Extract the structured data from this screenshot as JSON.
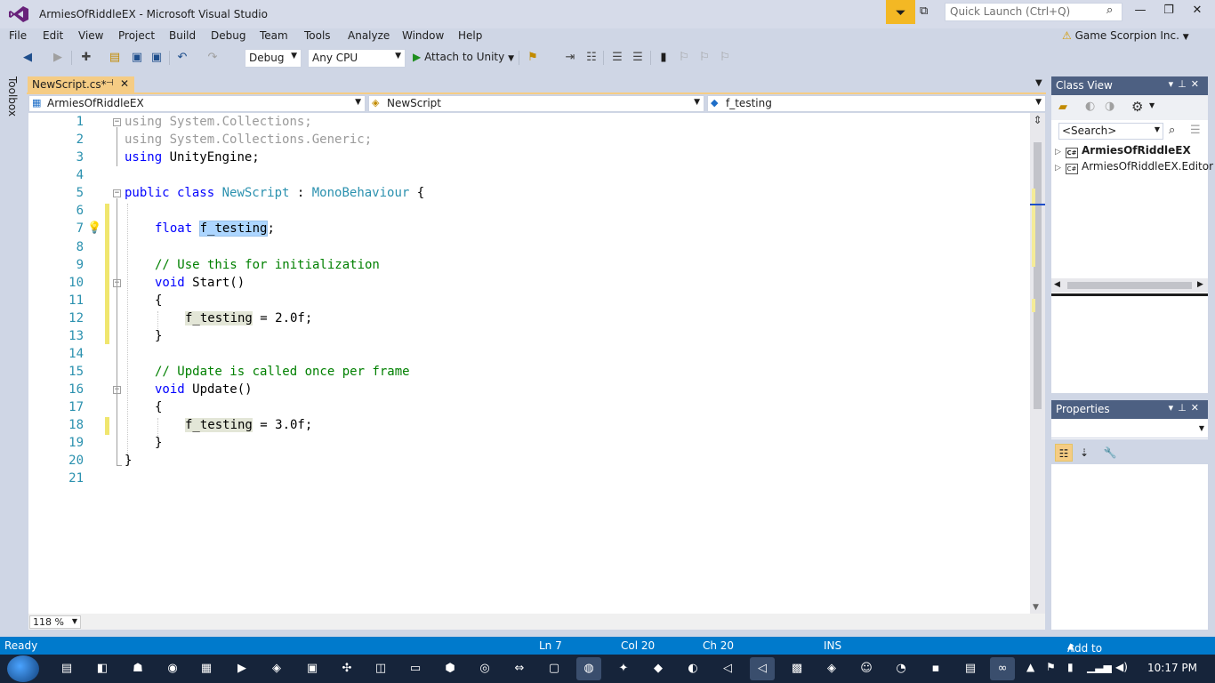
{
  "window": {
    "title": "ArmiesOfRiddleEX - Microsoft Visual Studio",
    "quick_launch_placeholder": "Quick Launch (Ctrl+Q)",
    "account": "Game Scorpion Inc.",
    "accent": "#007acc"
  },
  "menu": [
    "File",
    "Edit",
    "View",
    "Project",
    "Build",
    "Debug",
    "Team",
    "Tools",
    "Analyze",
    "Window",
    "Help"
  ],
  "toolbar": {
    "configuration": "Debug",
    "platform": "Any CPU",
    "attach_label": "Attach to Unity"
  },
  "sidebar": {
    "toolbox_label": "Toolbox"
  },
  "document": {
    "tab_title": "NewScript.cs*",
    "nav_project": "ArmiesOfRiddleEX",
    "nav_type": "NewScript",
    "nav_member": "f_testing",
    "zoom": "118 %"
  },
  "code_lines": [
    {
      "n": "1"
    },
    {
      "n": "2"
    },
    {
      "n": "3"
    },
    {
      "n": "4"
    },
    {
      "n": "5"
    },
    {
      "n": "6"
    },
    {
      "n": "7"
    },
    {
      "n": "8"
    },
    {
      "n": "9"
    },
    {
      "n": "10"
    },
    {
      "n": "11"
    },
    {
      "n": "12"
    },
    {
      "n": "13"
    },
    {
      "n": "14"
    },
    {
      "n": "15"
    },
    {
      "n": "16"
    },
    {
      "n": "17"
    },
    {
      "n": "18"
    },
    {
      "n": "19"
    },
    {
      "n": "20"
    },
    {
      "n": "21"
    }
  ],
  "code": {
    "l1_kw": "using",
    "l1_rest": " System.Collections;",
    "l2_kw": "using",
    "l2_rest": " System.Collections.Generic;",
    "l3_kw": "using",
    "l3_rest": " UnityEngine;",
    "l5_kw": "public class",
    "l5_type": "NewScript",
    "l5_colon": " : ",
    "l5_base": "MonoBehaviour",
    "l5_brace": " {",
    "l7_kw": "float",
    "l7_name": "f_testing",
    "l7_end": ";",
    "l9_comment": "// Use this for initialization",
    "l10_kw": "void",
    "l10_rest": " Start()",
    "l11": "{",
    "l12_name": "f_testing",
    "l12_rest": " = 2.0f;",
    "l13": "}",
    "l15_comment": "// Update is called once per frame",
    "l16_kw": "void",
    "l16_rest": " Update()",
    "l17": "{",
    "l18_name": "f_testing",
    "l18_rest": " = 3.0f;",
    "l19": "}",
    "l20": "}"
  },
  "class_view": {
    "title": "Class View",
    "search_placeholder": "<Search>",
    "items": [
      "ArmiesOfRiddleEX",
      "ArmiesOfRiddleEX.Editor"
    ]
  },
  "properties": {
    "title": "Properties"
  },
  "status": {
    "state": "Ready",
    "ln": "Ln 7",
    "col": "Col 20",
    "ch": "Ch 20",
    "mode": "INS",
    "source_control": "Add to Source Control"
  },
  "taskbar": {
    "time": "10:17 PM"
  }
}
